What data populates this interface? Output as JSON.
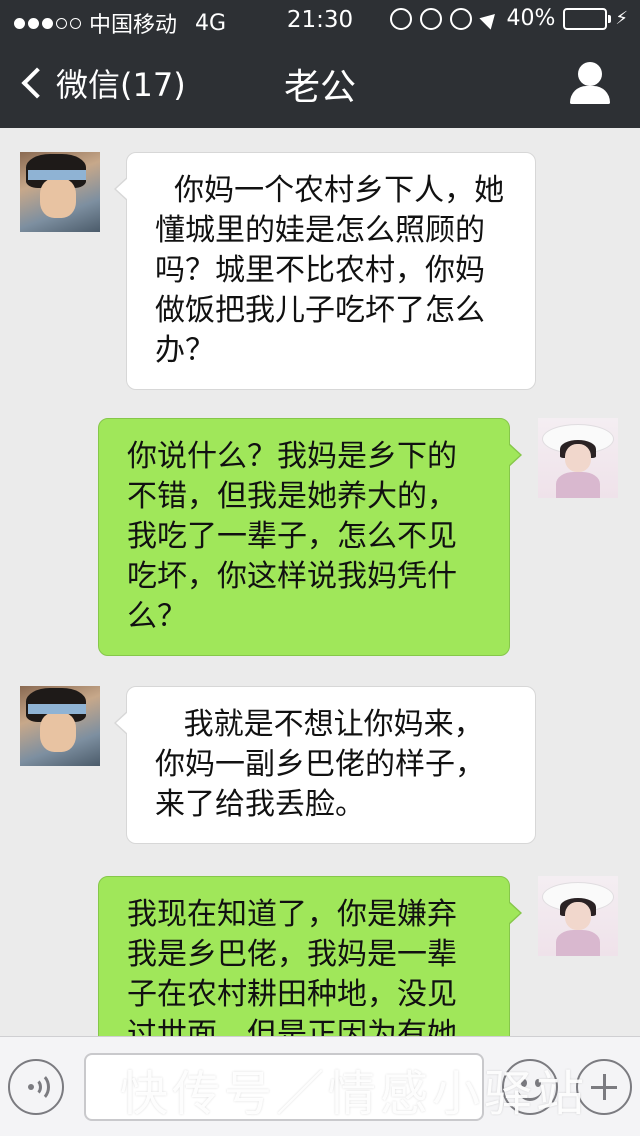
{
  "status_bar": {
    "carrier": "中国移动",
    "network": "4G",
    "time": "21:30",
    "battery": "40%",
    "battery_level": 0.4,
    "icons": [
      "signal-dots-icon",
      "plus-circle-icon",
      "rotation-lock-icon",
      "alarm-icon",
      "location-arrow-icon",
      "battery-icon",
      "charging-bolt-icon"
    ]
  },
  "nav": {
    "back_label": "微信(17)",
    "title": "老公"
  },
  "messages": [
    {
      "side": "left",
      "sender": "husband",
      "text": "  你妈一个农村乡下人，她懂城里的娃是怎么照顾的吗？城里不比农村，你妈做饭把我儿子吃坏了怎么办？"
    },
    {
      "side": "right",
      "sender": "me",
      "text": "你说什么？我妈是乡下的不错，但我是她养大的，我吃了一辈子，怎么不见吃坏，你这样说我妈凭什么？"
    },
    {
      "side": "left",
      "sender": "husband",
      "text": "   我就是不想让你妈来，你妈一副乡巴佬的样子，来了给我丢脸。"
    },
    {
      "side": "right",
      "sender": "me",
      "text": "我现在知道了，你是嫌弃我是乡巴佬，我妈是一辈子在农村耕田种地，没见过世面，但是正因为有她"
    }
  ],
  "input_bar": {
    "text_value": ""
  },
  "watermark": "快传号／情感小驿站",
  "colors": {
    "header_bg": "#2d3034",
    "chat_bg": "#ebebeb",
    "sent_bubble": "#a0e75a",
    "received_bubble": "#ffffff",
    "battery_fill": "#4cd964"
  }
}
